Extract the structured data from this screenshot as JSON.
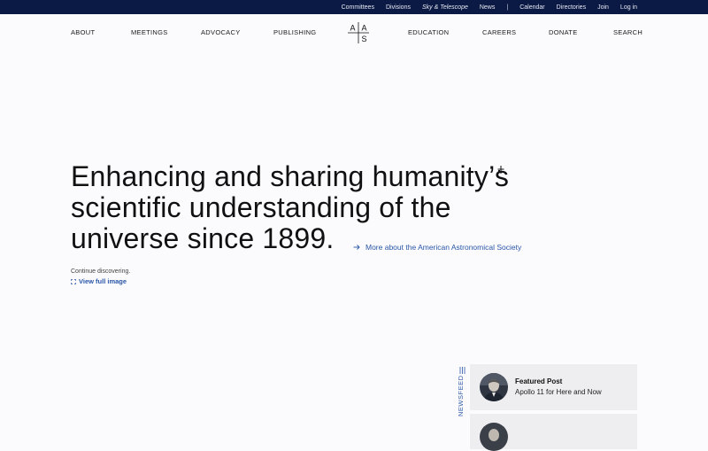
{
  "utility_nav": {
    "committees": "Committees",
    "divisions": "Divisions",
    "sky_telescope": "Sky & Telescope",
    "news": "News",
    "separator": "|",
    "calendar": "Calendar",
    "directories": "Directories",
    "join": "Join",
    "login": "Log in"
  },
  "main_nav": {
    "about": "ABOUT",
    "meetings": "MEETINGS",
    "advocacy": "ADVOCACY",
    "publishing": "PUBLISHING",
    "education": "EDUCATION",
    "careers": "CAREERS",
    "donate": "DONATE",
    "search": "SEARCH"
  },
  "logo": {
    "letters": [
      "A",
      "A",
      "S"
    ]
  },
  "hero": {
    "heading_lines": [
      "Enhancing and sharing humanity’s",
      "scientific understanding of the",
      "universe since 1899."
    ],
    "more_link": "More about the American Astronomical Society",
    "caption": "Continue discovering.",
    "view_full": "View full image"
  },
  "newsfeed": {
    "tab_label": "NEWSFEED",
    "cards": [
      {
        "title": "Featured Post",
        "subtitle": "Apollo 11 for Here and Now"
      }
    ]
  },
  "colors": {
    "topbar_bg": "#0b1a44",
    "accent_blue": "#2a56a8",
    "page_bg": "#fbfbfd",
    "card_bg": "#eeeef0"
  }
}
